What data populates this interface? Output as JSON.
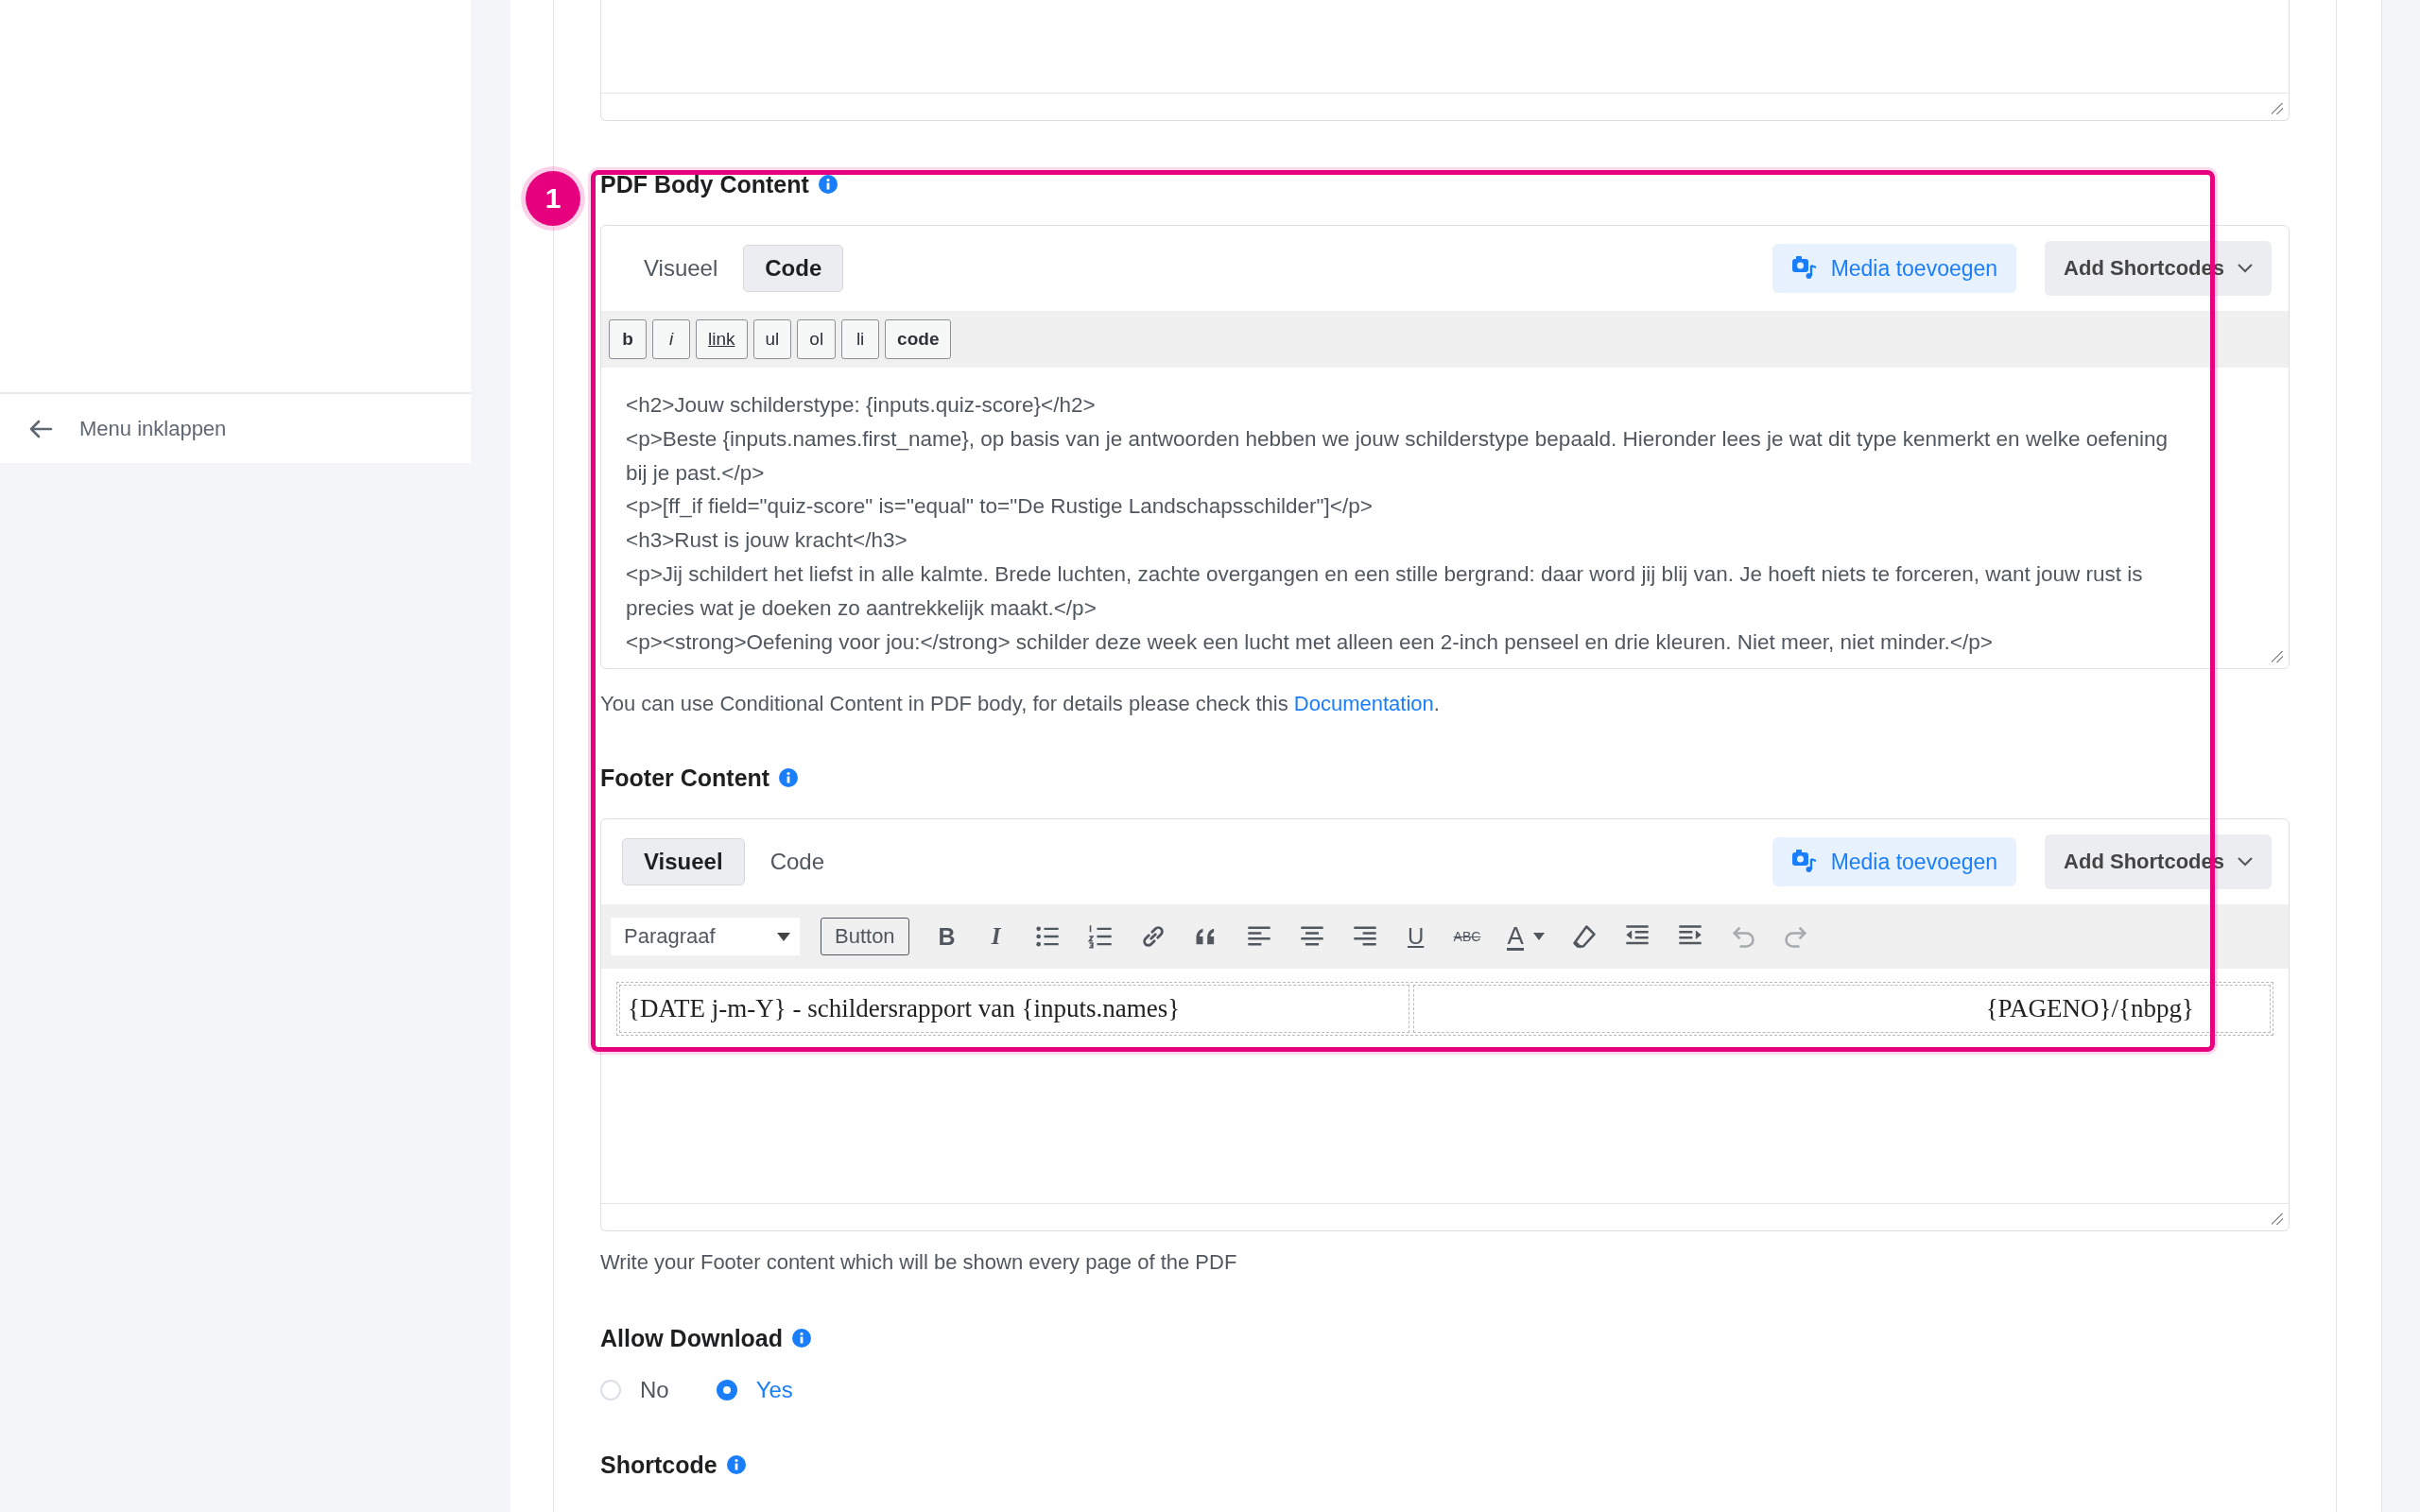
{
  "sidebar": {
    "collapse_label": "Menu inklappen"
  },
  "annotation": {
    "number": "1"
  },
  "body_section": {
    "title": "PDF Body Content",
    "editor": {
      "tabs": [
        {
          "label": "Visueel",
          "selected": false
        },
        {
          "label": "Code",
          "selected": true
        }
      ],
      "media_button": "Media toevoegen",
      "shortcodes_button": "Add Shortcodes",
      "quicktags": [
        "b",
        "i",
        "link",
        "ul",
        "ol",
        "li",
        "code"
      ],
      "code_lines": [
        "<h2>Jouw schilderstype: {inputs.quiz-score}</h2>",
        "<p>Beste {inputs.names.first_name}, op basis van je antwoorden hebben we jouw schilderstype bepaald. Hieronder lees je wat dit type kenmerkt en welke oefening bij je past.</p>",
        "<p>[ff_if field=\"quiz-score\" is=\"equal\" to=\"De Rustige Landschapsschilder\"]</p>",
        "<h3>Rust is jouw kracht</h3>",
        "<p>Jij schildert het liefst in alle kalmte. Brede luchten, zachte overgangen en een stille bergrand: daar word jij blij van. Je hoeft niets te forceren, want jouw rust is precies wat je doeken zo aantrekkelijk maakt.</p>",
        "<p><strong>Oefening voor jou:</strong> schilder deze week een lucht met alleen een 2-inch penseel en drie kleuren. Niet meer, niet minder.</p>"
      ]
    },
    "help": "You can use Conditional Content in PDF body, for details please check this",
    "help_link": "Documentation",
    "help_end": "."
  },
  "footer_section": {
    "title": "Footer Content",
    "editor": {
      "tabs": [
        {
          "label": "Visueel",
          "selected": true
        },
        {
          "label": "Code",
          "selected": false
        }
      ],
      "media_button": "Media toevoegen",
      "shortcodes_button": "Add Shortcodes",
      "format_select": "Paragraaf",
      "button_label": "Button",
      "toolbar": [
        {
          "kind": "bold",
          "glyph": "B"
        },
        {
          "kind": "italic",
          "glyph": "I"
        },
        {
          "kind": "bullets"
        },
        {
          "kind": "numbers"
        },
        {
          "kind": "link"
        },
        {
          "kind": "quote"
        },
        {
          "kind": "align-left"
        },
        {
          "kind": "align-center"
        },
        {
          "kind": "align-right"
        },
        {
          "kind": "underline",
          "glyph": "U"
        },
        {
          "kind": "strike",
          "glyph": "ABC"
        },
        {
          "kind": "color",
          "glyph": "A"
        },
        {
          "kind": "eraser"
        },
        {
          "kind": "outdent"
        },
        {
          "kind": "indent"
        },
        {
          "kind": "undo"
        },
        {
          "kind": "redo"
        }
      ],
      "cells": [
        "{DATE j-m-Y} - schildersrapport van {inputs.names}",
        "{PAGENO}/{nbpg}"
      ]
    },
    "help": "Write your Footer content which will be shown every page of the PDF"
  },
  "download_section": {
    "title": "Allow Download",
    "options": [
      {
        "label": "No",
        "selected": false
      },
      {
        "label": "Yes",
        "selected": true
      }
    ]
  },
  "shortcode_section": {
    "title": "Shortcode"
  }
}
